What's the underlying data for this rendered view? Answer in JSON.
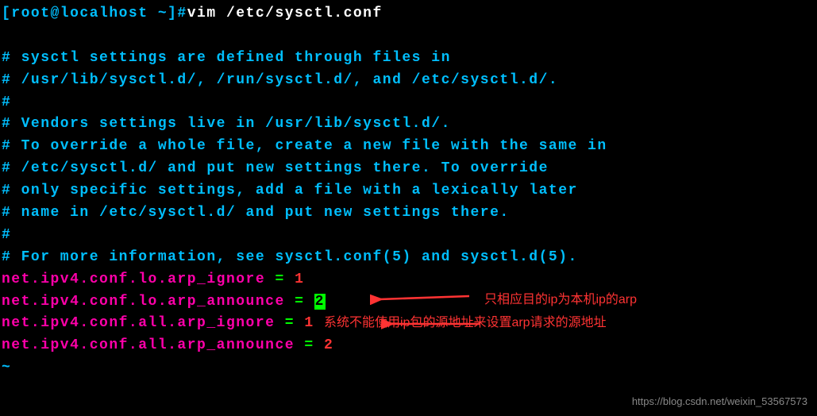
{
  "prompt": {
    "user_host": "[root@localhost ~]#",
    "command": "vim /etc/sysctl.conf"
  },
  "comments": [
    "# sysctl settings are defined through files in",
    "# /usr/lib/sysctl.d/, /run/sysctl.d/, and /etc/sysctl.d/.",
    "#",
    "# Vendors settings live in /usr/lib/sysctl.d/.",
    "# To override a whole file, create a new file with the same in",
    "# /etc/sysctl.d/ and put new settings there. To override",
    "# only specific settings, add a file with a lexically later",
    "# name in /etc/sysctl.d/ and put new settings there.",
    "#",
    "# For more information, see sysctl.conf(5) and sysctl.d(5)."
  ],
  "config_lines": [
    {
      "key": "net.ipv4.conf.lo.arp_ignore",
      "eq": " = ",
      "value": "1",
      "highlight": false
    },
    {
      "key": "net.ipv4.conf.lo.arp_announce",
      "eq": " = ",
      "value": "2",
      "highlight": true
    },
    {
      "key": "net.ipv4.conf.all.arp_ignore",
      "eq": " = ",
      "value": "1",
      "highlight": false
    },
    {
      "key": "net.ipv4.conf.all.arp_announce",
      "eq": " = ",
      "value": "2",
      "highlight": false
    }
  ],
  "annotations": {
    "a1": "只相应目的ip为本机ip的arp",
    "a2": "系统不能使用ip包的源地址来设置arp请求的源地址"
  },
  "watermark": "https://blog.csdn.net/weixin_53567573",
  "tilde": "~"
}
